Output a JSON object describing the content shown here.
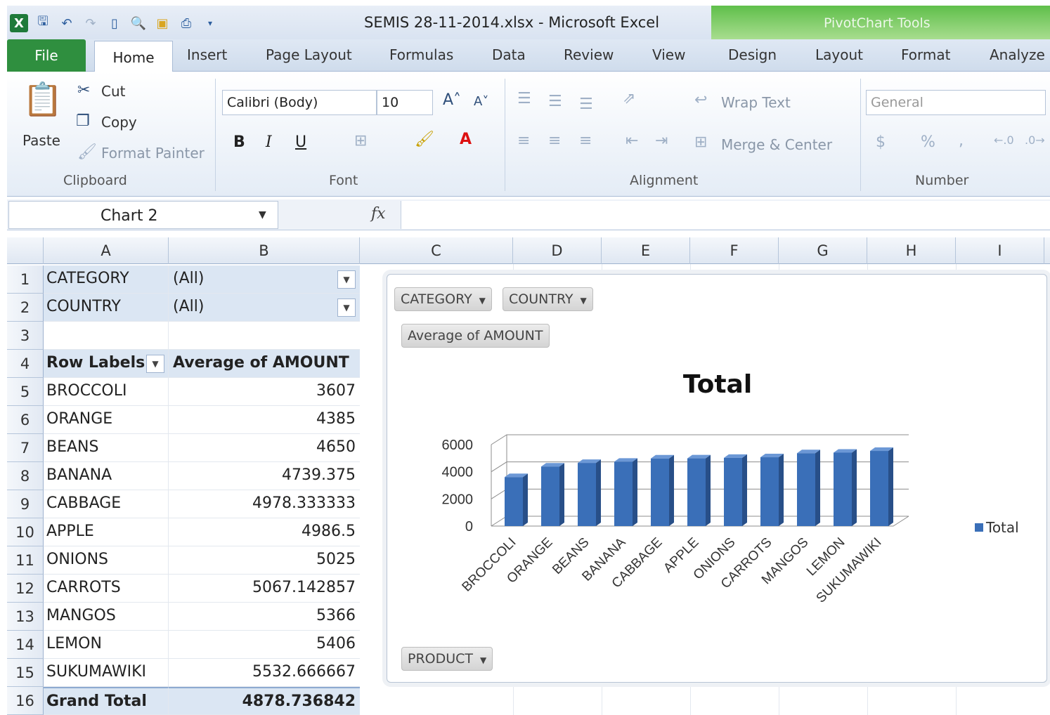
{
  "window": {
    "title": "SEMIS 28-11-2014.xlsx  -  Microsoft Excel",
    "contextual_tab_group": "PivotChart Tools"
  },
  "tabs": [
    "File",
    "Home",
    "Insert",
    "Page Layout",
    "Formulas",
    "Data",
    "Review",
    "View",
    "Design",
    "Layout",
    "Format",
    "Analyze"
  ],
  "ribbon": {
    "clipboard": {
      "paste": "Paste",
      "cut": "Cut",
      "copy": "Copy",
      "format_painter": "Format Painter",
      "label": "Clipboard"
    },
    "font": {
      "name": "Calibri (Body)",
      "size": "10",
      "label": "Font",
      "bold": "B",
      "italic": "I",
      "underline": "U"
    },
    "alignment": {
      "wrap_text": "Wrap Text",
      "merge_center": "Merge & Center",
      "label": "Alignment"
    },
    "number": {
      "format": "General",
      "label": "Number",
      "currency": "$",
      "percent": "%",
      "comma": ","
    }
  },
  "formula_bar": {
    "name_box": "Chart 2",
    "fx": "fx"
  },
  "columns": [
    "A",
    "B",
    "C",
    "D",
    "E",
    "F",
    "G",
    "H",
    "I"
  ],
  "sheet": {
    "filters": [
      {
        "row": "1",
        "label": "CATEGORY",
        "value": "(All)"
      },
      {
        "row": "2",
        "label": "COUNTRY",
        "value": "(All)"
      }
    ],
    "empty_row": "3",
    "header": {
      "row": "4",
      "col_a": "Row Labels",
      "col_b": "Average of AMOUNT"
    },
    "rows": [
      {
        "row": "5",
        "label": "BROCCOLI",
        "value": "3607"
      },
      {
        "row": "6",
        "label": "ORANGE",
        "value": "4385"
      },
      {
        "row": "7",
        "label": "BEANS",
        "value": "4650"
      },
      {
        "row": "8",
        "label": "BANANA",
        "value": "4739.375"
      },
      {
        "row": "9",
        "label": "CABBAGE",
        "value": "4978.333333"
      },
      {
        "row": "10",
        "label": "APPLE",
        "value": "4986.5"
      },
      {
        "row": "11",
        "label": "ONIONS",
        "value": "5025"
      },
      {
        "row": "12",
        "label": "CARROTS",
        "value": "5067.142857"
      },
      {
        "row": "13",
        "label": "MANGOS",
        "value": "5366"
      },
      {
        "row": "14",
        "label": "LEMON",
        "value": "5406"
      },
      {
        "row": "15",
        "label": "SUKUMAWIKI",
        "value": "5532.666667"
      }
    ],
    "grand_total": {
      "row": "16",
      "label": "Grand Total",
      "value": "4878.736842"
    }
  },
  "chart": {
    "field_buttons": {
      "category": "CATEGORY",
      "country": "COUNTRY",
      "values": "Average of AMOUNT",
      "axis": "PRODUCT"
    },
    "legend": "Total",
    "bar_color": "#3a6fb8"
  },
  "chart_data": {
    "type": "bar",
    "title": "Total",
    "categories": [
      "BROCCOLI",
      "ORANGE",
      "BEANS",
      "BANANA",
      "CABBAGE",
      "APPLE",
      "ONIONS",
      "CARROTS",
      "MANGOS",
      "LEMON",
      "SUKUMAWIKI"
    ],
    "series": [
      {
        "name": "Total",
        "values": [
          3607,
          4385,
          4650,
          4739.375,
          4978.333333,
          4986.5,
          5025,
          5067.142857,
          5366,
          5406,
          5532.666667
        ]
      }
    ],
    "yticks": [
      "0",
      "2000",
      "4000",
      "6000"
    ],
    "ylim": [
      0,
      6000
    ],
    "legend_position": "right",
    "grid": true
  }
}
